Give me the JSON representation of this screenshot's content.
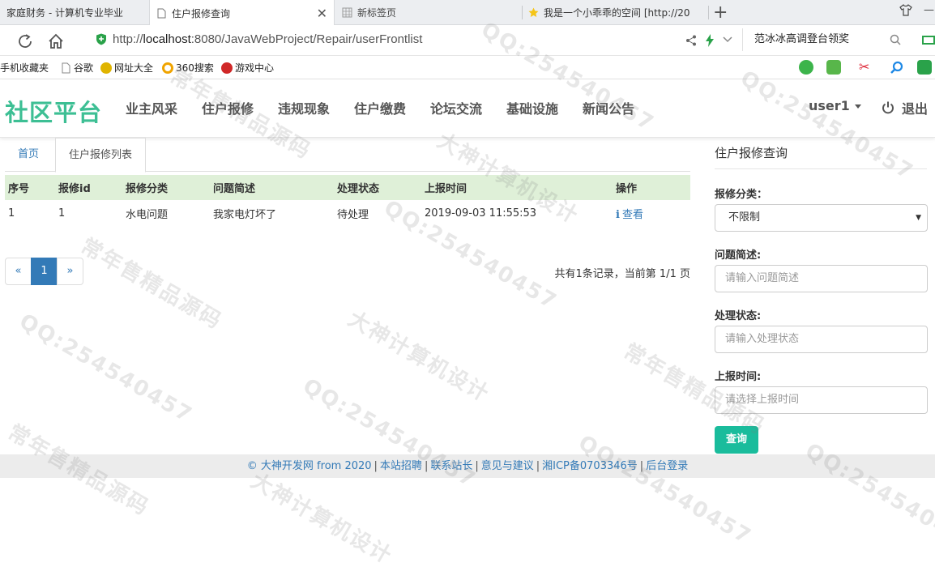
{
  "browser": {
    "tabs": [
      {
        "label": "家庭财务 - 计算机专业毕业"
      },
      {
        "label": "住户报修查询"
      },
      {
        "label": "新标签页"
      },
      {
        "label": "我是一个小乖乖的空间 [http://20"
      }
    ],
    "url_prefix": "http://",
    "url_host": "localhost",
    "url_rest": ":8080/JavaWebProject/Repair/userFrontlist",
    "search_text": "范冰冰高调登台领奖",
    "bookmarks": [
      "手机收藏夹",
      "谷歌",
      "网址大全",
      "360搜索",
      "游戏中心"
    ]
  },
  "site": {
    "brand": "社区平台",
    "nav": [
      "业主风采",
      "住户报修",
      "违规现象",
      "住户缴费",
      "论坛交流",
      "基础设施",
      "新闻公告"
    ],
    "user": "user1",
    "logout": "退出"
  },
  "content_tabs": {
    "home": "首页",
    "active": "住户报修列表"
  },
  "table": {
    "headers": [
      "序号",
      "报修id",
      "报修分类",
      "问题简述",
      "处理状态",
      "上报时间",
      "操作"
    ],
    "rows": [
      {
        "index": "1",
        "id": "1",
        "category": "水电问题",
        "summary": "我家电灯坏了",
        "status": "待处理",
        "time": "2019-09-03 11:55:53",
        "action": "查看"
      }
    ]
  },
  "pagination": {
    "prev": "«",
    "current": "1",
    "next": "»",
    "info": "共有1条记录，当前第 1/1 页"
  },
  "query": {
    "title": "住户报修查询",
    "category_label": "报修分类：",
    "category_value": "不限制",
    "summary_label": "问题简述:",
    "summary_placeholder": "请输入问题简述",
    "status_label": "处理状态:",
    "status_placeholder": "请输入处理状态",
    "time_label": "上报时间:",
    "time_placeholder": "请选择上报时间",
    "button": "查询"
  },
  "footer": {
    "copyright": "© 大神开发网 from 2020",
    "links": [
      "本站招聘",
      "联系站长",
      "意见与建议",
      "湘ICP备0703346号",
      "后台登录"
    ]
  },
  "watermarks": {
    "qq": "QQ:254540457",
    "a": "常年售精品源码",
    "b": "大神计算机设计"
  },
  "colors": {
    "brand": "#3dbf94",
    "link": "#337ab7",
    "header_row": "#dff0d8",
    "button": "#1abc9c",
    "footer_bg": "#ececec"
  }
}
